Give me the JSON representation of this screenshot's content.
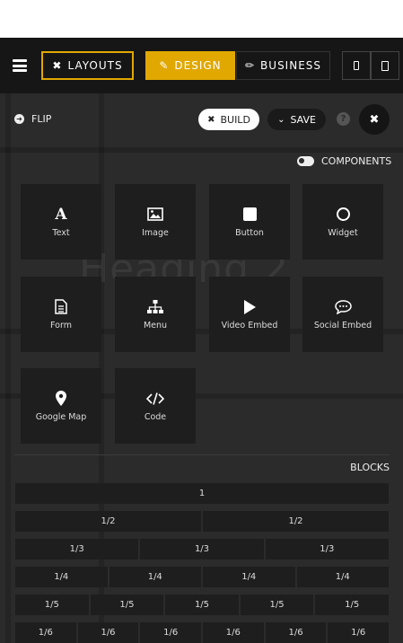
{
  "toolbar": {
    "layouts_label": "LAYOUTS",
    "design_label": "DESIGN",
    "business_label": "BUSINESS"
  },
  "panel": {
    "flip_label": "FLIP",
    "build_label": "BUILD",
    "save_label": "SAVE",
    "help_label": "?",
    "components_label": "COMPONENTS",
    "background_heading": "Heading 2"
  },
  "components": [
    {
      "label": "Text",
      "icon": "text-icon"
    },
    {
      "label": "Image",
      "icon": "image-icon"
    },
    {
      "label": "Button",
      "icon": "button-icon"
    },
    {
      "label": "Widget",
      "icon": "widget-icon"
    },
    {
      "label": "Form",
      "icon": "form-icon"
    },
    {
      "label": "Menu",
      "icon": "menu-sitemap-icon"
    },
    {
      "label": "Video Embed",
      "icon": "play-icon"
    },
    {
      "label": "Social Embed",
      "icon": "chat-icon"
    },
    {
      "label": "Google Map",
      "icon": "map-pin-icon"
    },
    {
      "label": "Code",
      "icon": "code-icon"
    }
  ],
  "blocks": {
    "title": "BLOCKS",
    "rows": [
      [
        "1"
      ],
      [
        "1/2",
        "1/2"
      ],
      [
        "1/3",
        "1/3",
        "1/3"
      ],
      [
        "1/4",
        "1/4",
        "1/4",
        "1/4"
      ],
      [
        "1/5",
        "1/5",
        "1/5",
        "1/5",
        "1/5"
      ],
      [
        "1/6",
        "1/6",
        "1/6",
        "1/6",
        "1/6",
        "1/6"
      ]
    ]
  },
  "colors": {
    "accent": "#e0a800",
    "panel_bg": "#2b2b2b",
    "tile_bg": "#1e1e1e",
    "topbar_bg": "#161616"
  }
}
